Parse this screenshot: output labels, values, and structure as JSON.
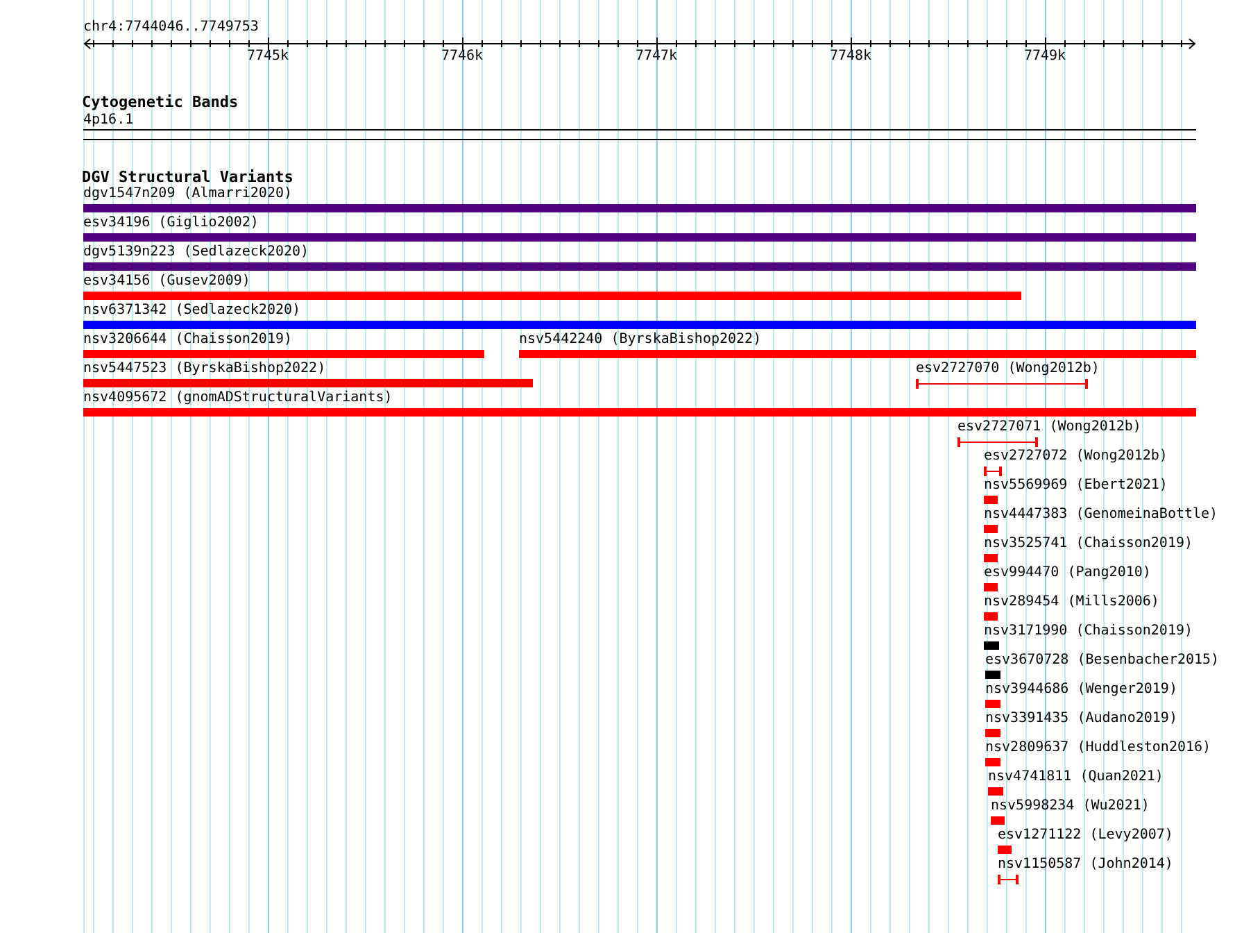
{
  "ruler": {
    "location": "chr4:7744046..7749753",
    "ticks": [
      "7745k",
      "7746k",
      "7747k",
      "7748k",
      "7749k"
    ]
  },
  "cytogenetic_bands": {
    "title": "Cytogenetic Bands",
    "band": "4p16.1"
  },
  "structural_variants": {
    "title": "DGV Structural Variants",
    "features": [
      {
        "label": "dgv1547n209 (Almarri2020)",
        "kind": "bar",
        "color": "#500082"
      },
      {
        "label": "esv34196 (Giglio2002)",
        "kind": "bar",
        "color": "#500082"
      },
      {
        "label": "dgv5139n223 (Sedlazeck2020)",
        "kind": "bar",
        "color": "#500082"
      },
      {
        "label": "esv34156 (Gusev2009)",
        "kind": "bar",
        "color": "#ff0000"
      },
      {
        "label": "nsv6371342 (Sedlazeck2020)",
        "kind": "bar",
        "color": "#0000ff"
      },
      {
        "label": "nsv3206644 (Chaisson2019)",
        "kind": "bar",
        "color": "#ff0000"
      },
      {
        "label": "nsv5442240 (ByrskaBishop2022)",
        "kind": "bar",
        "color": "#ff0000"
      },
      {
        "label": "nsv5447523 (ByrskaBishop2022)",
        "kind": "bar",
        "color": "#ff0000"
      },
      {
        "label": "esv2727070 (Wong2012b)",
        "kind": "span",
        "color": "#ff0000"
      },
      {
        "label": "nsv4095672 (gnomADStructuralVariants)",
        "kind": "bar",
        "color": "#ff0000"
      },
      {
        "label": "esv2727071 (Wong2012b)",
        "kind": "span",
        "color": "#ff0000"
      },
      {
        "label": "esv2727072 (Wong2012b)",
        "kind": "span",
        "color": "#ff0000"
      },
      {
        "label": "nsv5569969 (Ebert2021)",
        "kind": "bar",
        "color": "#ff0000"
      },
      {
        "label": "nsv4447383 (GenomeinaBottle)",
        "kind": "bar",
        "color": "#ff0000"
      },
      {
        "label": "nsv3525741 (Chaisson2019)",
        "kind": "bar",
        "color": "#ff0000"
      },
      {
        "label": "esv994470 (Pang2010)",
        "kind": "bar",
        "color": "#ff0000"
      },
      {
        "label": "nsv289454 (Mills2006)",
        "kind": "bar",
        "color": "#ff0000"
      },
      {
        "label": "nsv3171990 (Chaisson2019)",
        "kind": "bar",
        "color": "#000000"
      },
      {
        "label": "esv3670728 (Besenbacher2015)",
        "kind": "bar",
        "color": "#000000"
      },
      {
        "label": "nsv3944686 (Wenger2019)",
        "kind": "bar",
        "color": "#ff0000"
      },
      {
        "label": "nsv3391435 (Audano2019)",
        "kind": "bar",
        "color": "#ff0000"
      },
      {
        "label": "nsv2809637 (Huddleston2016)",
        "kind": "bar",
        "color": "#ff0000"
      },
      {
        "label": "nsv4741811 (Quan2021)",
        "kind": "bar",
        "color": "#ff0000"
      },
      {
        "label": "nsv5998234 (Wu2021)",
        "kind": "bar",
        "color": "#ff0000"
      },
      {
        "label": "esv1271122 (Levy2007)",
        "kind": "bar",
        "color": "#ff0000"
      },
      {
        "label": "nsv1150587 (John2014)",
        "kind": "span",
        "color": "#ff0000"
      }
    ]
  }
}
